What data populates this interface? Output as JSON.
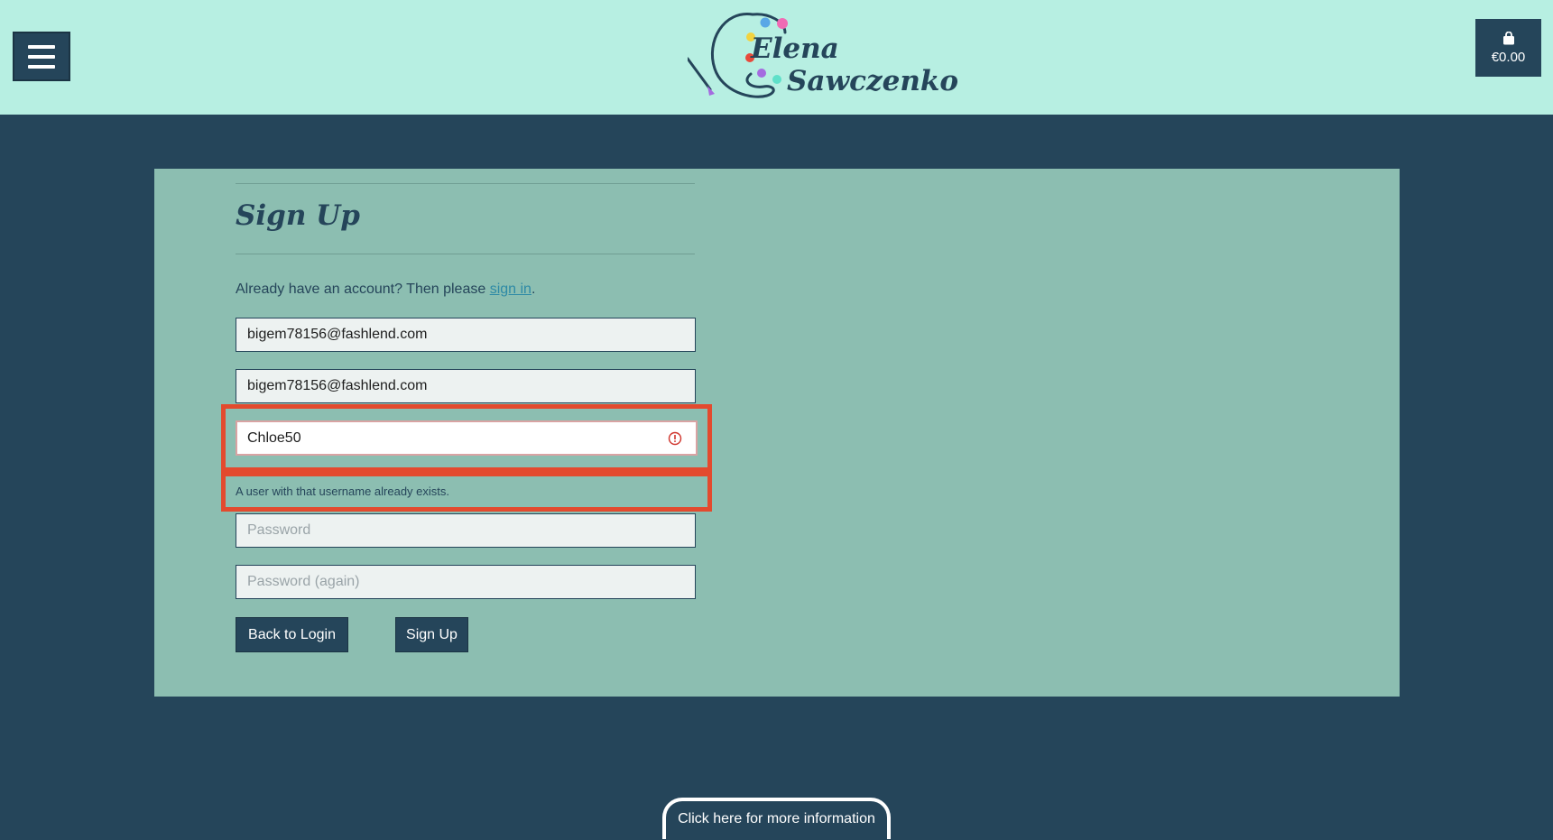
{
  "brand": {
    "first_name": "Elena",
    "last_name": "Sawczenko",
    "palette_colors": [
      "#f06bb4",
      "#5aa7e6",
      "#f2d33f",
      "#e8493b",
      "#a46be0",
      "#5fe0c9"
    ]
  },
  "header": {
    "cart_total": "€0.00"
  },
  "signup": {
    "title": "Sign Up",
    "already_text": "Already have an account? Then please ",
    "signin_link": "sign in",
    "already_end": ".",
    "email": "bigem78156@fashlend.com",
    "email_confirm": "bigem78156@fashlend.com",
    "username": "Chloe50",
    "username_error": "A user with that username already exists.",
    "password_placeholder": "Password",
    "password_again_placeholder": "Password (again)",
    "back_button": "Back to Login",
    "signup_button": "Sign Up"
  },
  "footer": {
    "more_info": "Click here for more information"
  },
  "colors": {
    "header_bg": "#b7efe2",
    "page_bg": "#25455a",
    "card_bg": "#8cbeb1",
    "highlight": "#e34a2e"
  }
}
